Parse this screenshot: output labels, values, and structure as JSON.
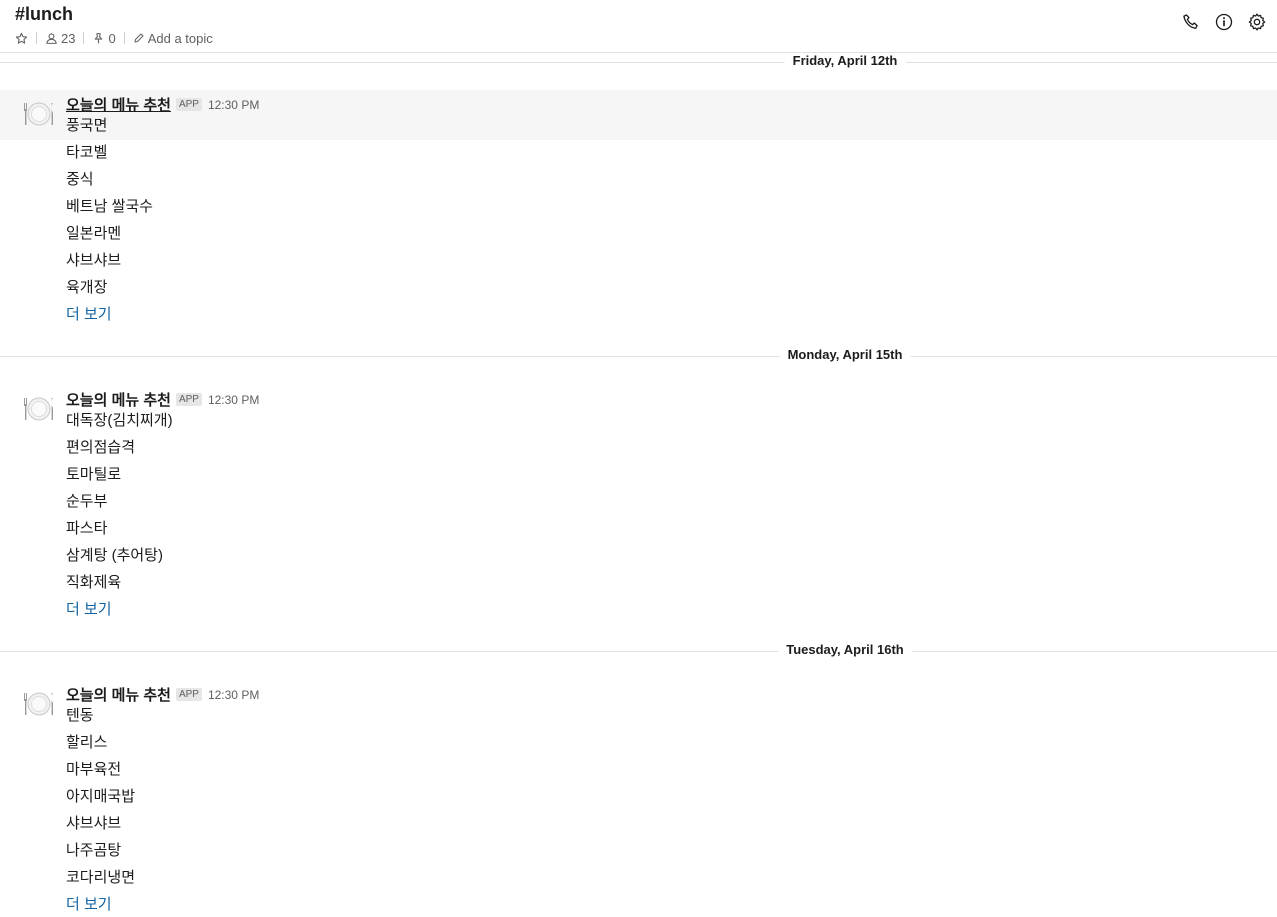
{
  "channel": {
    "name": "#lunch",
    "member_count": "23",
    "pinned_count": "0",
    "add_topic_label": "Add a topic"
  },
  "icons": {
    "star": "star-icon",
    "members": "person-icon",
    "pins": "pin-icon",
    "topic": "pencil-icon",
    "call": "phone-icon",
    "details": "info-icon",
    "settings": "gear-icon",
    "avatar": "fork-plate-knife-icon"
  },
  "colors": {
    "link": "#1264a3",
    "divider": "#e1e1e1",
    "hover_row": "#f6f6f6",
    "muted_text": "#616061"
  },
  "days": [
    {
      "date_label": "Friday, April 12th",
      "message": {
        "sender": "오늘의 메뉴 추천",
        "badge": "APP",
        "time": "12:30 PM",
        "items": [
          "풍국면",
          "타코벨",
          "중식",
          "베트남 쌀국수",
          "일본라멘",
          "샤브샤브",
          "육개장"
        ],
        "more_label": "더 보기"
      }
    },
    {
      "date_label": "Monday, April 15th",
      "message": {
        "sender": "오늘의 메뉴 추천",
        "badge": "APP",
        "time": "12:30 PM",
        "items": [
          "대독장(김치찌개)",
          "편의점습격",
          "토마틸로",
          "순두부",
          "파스타",
          "삼계탕 (추어탕)",
          "직화제육"
        ],
        "more_label": "더 보기"
      }
    },
    {
      "date_label": "Tuesday, April 16th",
      "message": {
        "sender": "오늘의 메뉴 추천",
        "badge": "APP",
        "time": "12:30 PM",
        "items": [
          "텐동",
          "할리스",
          "마부육전",
          "아지매국밥",
          "샤브샤브",
          "나주곰탕",
          "코다리냉면"
        ],
        "more_label": "더 보기"
      }
    }
  ]
}
